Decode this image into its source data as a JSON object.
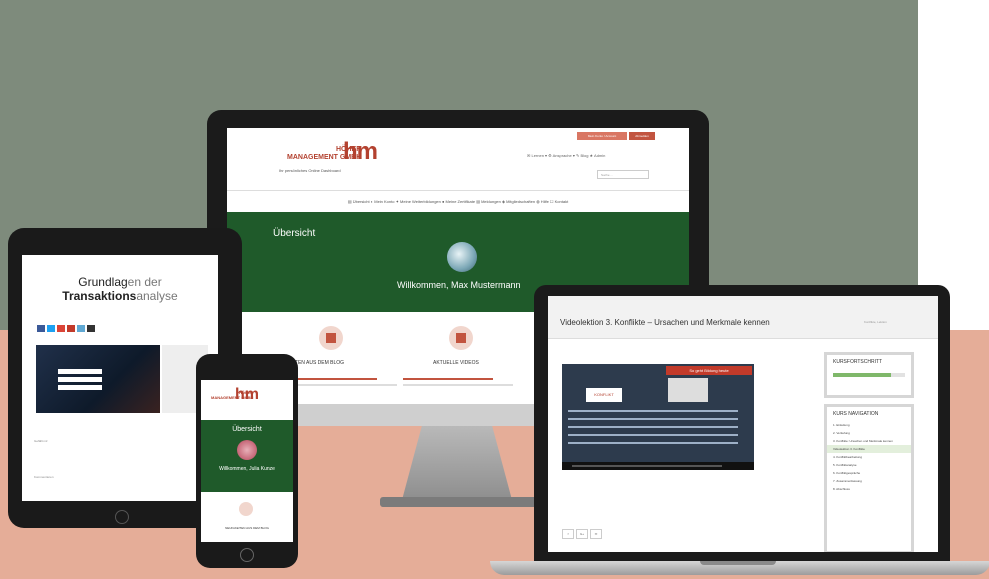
{
  "imac": {
    "logo_line1": "HÖHER",
    "logo_line2": "MANAGEMENT GMBH",
    "logo_mark": "hm",
    "subtitle": "Ihr persönliches Online Dashboard",
    "btn_primary": "Mein Konto / Account",
    "btn_secondary": "Abmelden",
    "top_menu": "✉ Lernen ▾    ⚙ Ansprache ▾    ✎ Blog    ★ Admin",
    "search_placeholder": "Suche ...",
    "nav": "▤ Übersicht    ◐ Mein Konto    ✦ Meine Weiterbildungen    ● Meine Zertifikate    ▤ Meldungen    ◈ Mitgliedschaften    ◍ Hilfe    ☐ Kontakt",
    "section_title": "Übersicht",
    "welcome": "Willkommen, Max Mustermann",
    "col1_label": "NEUIGKEITEN AUS DEM BLOG",
    "col2_label": "AKTUELLE VIDEOS"
  },
  "ipad": {
    "title_part1": "Grundlag",
    "title_part2": "en der",
    "title_part3": "Transaktions",
    "title_part4": "analyse",
    "small_text1": "Gefällt mir",
    "small_text2": "Kommentieren"
  },
  "iphone": {
    "logo_line1": "HÖHER",
    "logo_line2": "MANAGEMENT GMBH",
    "logo_mark": "hm",
    "section_title": "Übersicht",
    "welcome": "Willkommen, Julia Kunze",
    "label": "NEUIGKEITEN AUS DEM BLOG"
  },
  "macbook": {
    "title": "Videolektion 3. Konflikte – Ursachen und Merkmale kennen",
    "breadcrumb": "Konflikte, Lektion",
    "banner": "So geht Bildung heute",
    "logo": "KONFLIKT",
    "progress_title": "KURSFORTSCHRITT",
    "progress_value": 0.8,
    "nav_title": "KURS NAVIGATION",
    "nav_items": [
      "1. Einleitung",
      "2. Vertiefung",
      "3. Konflikte: Ursachen und Merkmale kennen",
      "Videolektion 3. Konflikte",
      "4. Konfliktbearbeitung",
      "5. Konfliktanalyse",
      "6. Konfliktgespräche",
      "7. Zusammenfassung",
      "8. Abschluss"
    ],
    "social": [
      "f",
      "G+",
      "✉"
    ]
  },
  "colors": {
    "brand_red": "#b3412f",
    "dash_green": "#1f5a2a",
    "bg_sage": "#7e8b7c",
    "bg_peach": "#e5ad98",
    "progress_green": "#7fb86a"
  }
}
